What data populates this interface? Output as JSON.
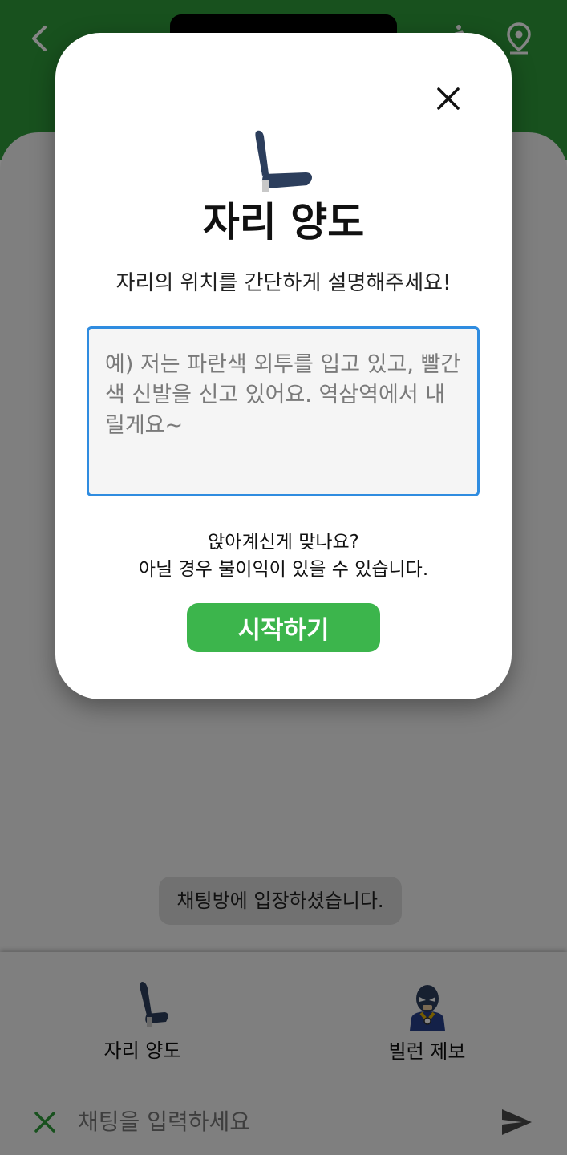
{
  "dialog": {
    "title": "자리 양도",
    "subtitle": "자리의 위치를 간단하게 설명해주세요!",
    "input_placeholder": "예) 저는 파란색 외투를 입고 있고, 빨간색 신발을 신고 있어요. 역삼역에서 내릴게요~",
    "confirm_line1": "앉아계신게 맞나요?",
    "confirm_line2": "아닐 경우 불이익이 있을 수 있습니다.",
    "start_label": "시작하기"
  },
  "chat": {
    "system_message": "채팅방에 입장하셨습니다.",
    "input_placeholder": "채팅을 입력하세요"
  },
  "actions": {
    "yield_label": "자리 양도",
    "villain_label": "빌런 제보"
  },
  "colors": {
    "header_green": "#2e9c3b",
    "start_button": "#3cb54c",
    "input_border": "#2f8ce0",
    "seat_blue": "#2c3e5c"
  },
  "icons": {
    "back": "chevron-left-icon",
    "train": "train-icon",
    "location": "location-pin-icon",
    "close": "close-icon",
    "seat": "seat-icon",
    "villain": "villain-mask-icon",
    "dismiss": "x-icon",
    "send": "send-icon"
  }
}
